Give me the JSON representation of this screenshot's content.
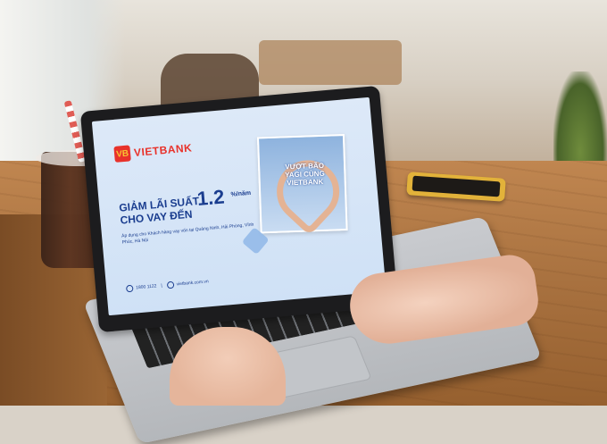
{
  "ad": {
    "brand": "VIETBANK",
    "logo_mark": "VB",
    "headline_line1": "GIẢM LÃI SUẤT",
    "headline_line2": "CHO VAY ĐẾN",
    "rate": "1.2",
    "rate_unit": "%/năm",
    "subtext": "Áp dụng cho Khách hàng vay vốn tại Quảng Ninh, Hải Phòng, Vĩnh Phúc, Hà Nội",
    "hotline": "1800 1122",
    "website": "vietbank.com.vn",
    "photo_title": "VƯỢT BÃO YAGI CÙNG VIETBANK"
  },
  "colors": {
    "brand_red": "#e8322b",
    "brand_blue": "#1a3d8f",
    "screen_bg": "#dde9f8"
  }
}
